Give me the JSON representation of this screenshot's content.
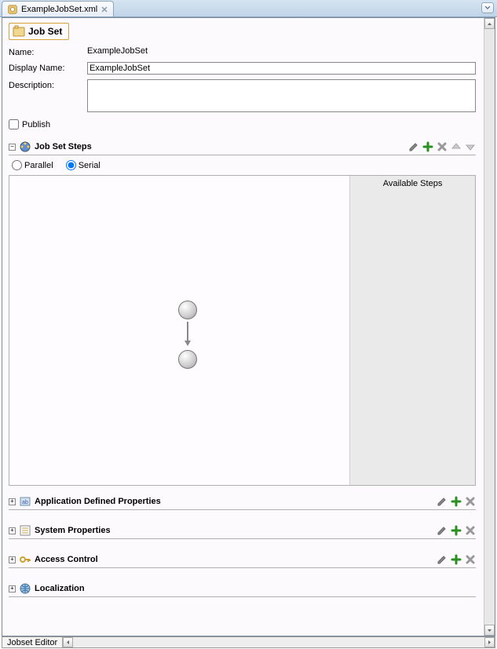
{
  "tab": {
    "filename": "ExampleJobSet.xml"
  },
  "header": {
    "title": "Job Set"
  },
  "form": {
    "name_label": "Name:",
    "name_value": "ExampleJobSet",
    "display_name_label": "Display Name:",
    "display_name_value": "ExampleJobSet",
    "description_label": "Description:",
    "description_value": "",
    "publish_label": "Publish"
  },
  "steps_section": {
    "title": "Job Set Steps",
    "parallel_label": "Parallel",
    "serial_label": "Serial",
    "serial_selected": true,
    "available_title": "Available Steps"
  },
  "sections": {
    "app_props": "Application Defined Properties",
    "sys_props": "System Properties",
    "access": "Access Control",
    "local": "Localization"
  },
  "status": {
    "label": "Jobset Editor"
  }
}
